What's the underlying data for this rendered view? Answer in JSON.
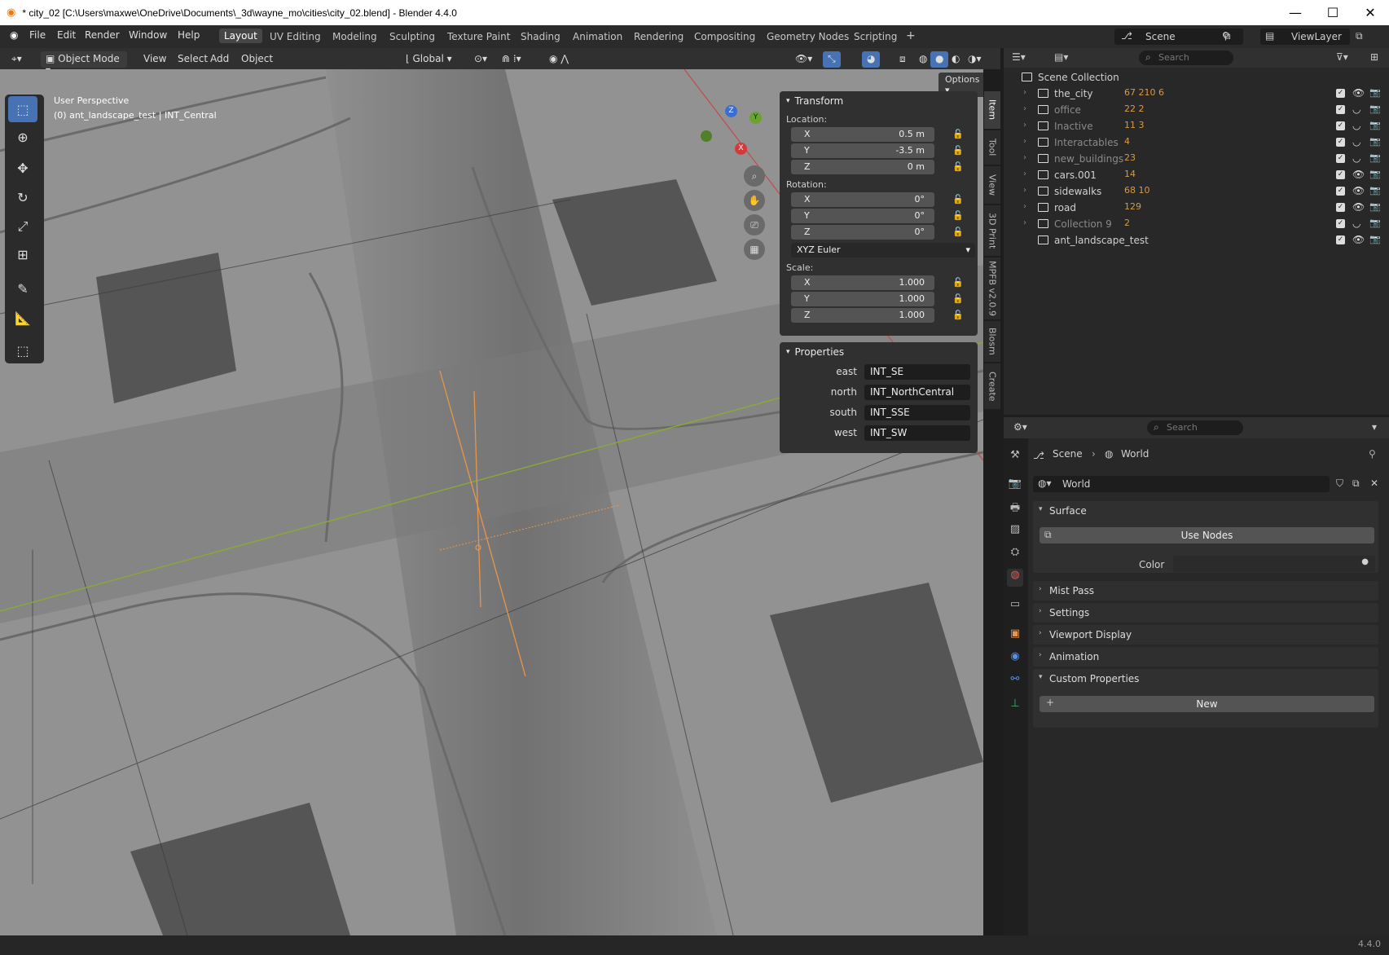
{
  "window": {
    "title": "* city_02 [C:\\Users\\maxwe\\OneDrive\\Documents\\_3d\\wayne_mo\\cities\\city_02.blend] - Blender 4.4.0"
  },
  "menu": [
    "File",
    "Edit",
    "Render",
    "Window",
    "Help"
  ],
  "workspaces": [
    "Layout",
    "UV Editing",
    "Modeling",
    "Sculpting",
    "Texture Paint",
    "Shading",
    "Animation",
    "Rendering",
    "Compositing",
    "Geometry Nodes",
    "Scripting"
  ],
  "scene": {
    "name": "Scene",
    "view_layer": "ViewLayer"
  },
  "header3d": {
    "mode": "Object Mode",
    "view": "View",
    "select": "Select",
    "add": "Add",
    "object": "Object",
    "orientation": "Global",
    "options": "Options"
  },
  "viewport": {
    "perspective": "User Perspective",
    "info": "(0) ant_landscape_test | INT_Central"
  },
  "transform": {
    "title": "Transform",
    "location_label": "Location:",
    "location": {
      "x": "0.5 m",
      "y": "-3.5 m",
      "z": "0 m"
    },
    "rotation_label": "Rotation:",
    "rotation": {
      "x": "0°",
      "y": "0°",
      "z": "0°"
    },
    "rotation_mode": "XYZ Euler",
    "scale_label": "Scale:",
    "scale": {
      "x": "1.000",
      "y": "1.000",
      "z": "1.000"
    },
    "axes": {
      "x": "X",
      "y": "Y",
      "z": "Z"
    }
  },
  "properties_panel": {
    "title": "Properties",
    "items": [
      {
        "key": "east",
        "value": "INT_SE"
      },
      {
        "key": "north",
        "value": "INT_NorthCentral"
      },
      {
        "key": "south",
        "value": "INT_SSE"
      },
      {
        "key": "west",
        "value": "INT_SW"
      }
    ]
  },
  "sidetabs": [
    "Item",
    "Tool",
    "View",
    "3D Print",
    "MPFB v2.0.9",
    "Blosm",
    "Create"
  ],
  "outliner": {
    "search": "Search",
    "root": "Scene Collection",
    "rows": [
      {
        "name": "the_city",
        "dim": false,
        "counts": "67 210 6"
      },
      {
        "name": "office",
        "dim": true,
        "counts": "22 2"
      },
      {
        "name": "Inactive",
        "dim": true,
        "counts": "11 3"
      },
      {
        "name": "Interactables",
        "dim": true,
        "counts": "4"
      },
      {
        "name": "new_buildings",
        "dim": true,
        "counts": "23"
      },
      {
        "name": "cars.001",
        "dim": false,
        "counts": "14"
      },
      {
        "name": "sidewalks",
        "dim": false,
        "counts": "68 10"
      },
      {
        "name": "road",
        "dim": false,
        "counts": "129"
      },
      {
        "name": "Collection 9",
        "dim": true,
        "counts": "2"
      },
      {
        "name": "ant_landscape_test",
        "dim": false,
        "counts": ""
      }
    ]
  },
  "props": {
    "search": "Search",
    "breadcrumb": {
      "scene": "Scene",
      "world": "World"
    },
    "world_name": "World",
    "surface": "Surface",
    "use_nodes": "Use Nodes",
    "color_label": "Color",
    "sections": [
      "Mist Pass",
      "Settings",
      "Viewport Display",
      "Animation"
    ],
    "custom_props": "Custom Properties",
    "new": "New"
  },
  "status": {
    "version": "4.4.0"
  },
  "colors": {
    "accent": "#4772b3",
    "orange": "#e8964a"
  }
}
